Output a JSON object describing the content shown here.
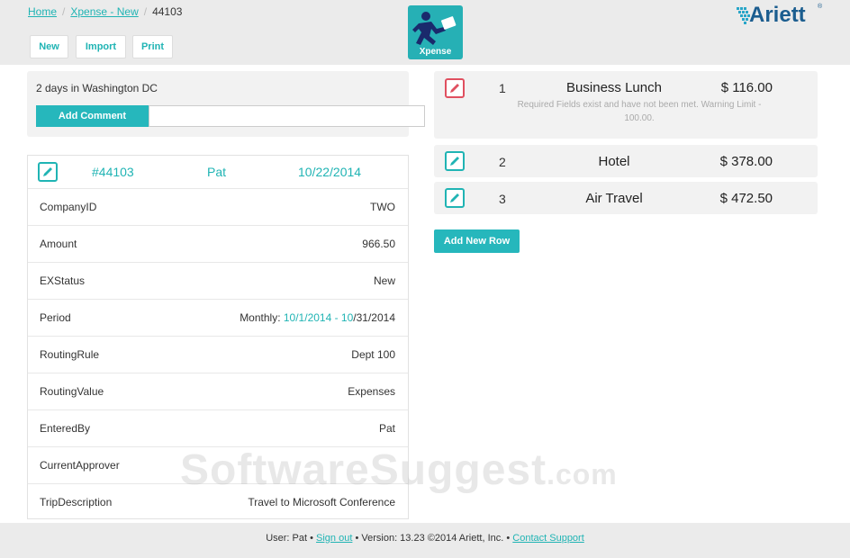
{
  "breadcrumb": {
    "home": "Home",
    "app": "Xpense - New",
    "current": "44103"
  },
  "toolbar": {
    "new_label": "New",
    "import_label": "Import",
    "print_label": "Print"
  },
  "app_logo": {
    "label": "Xpense",
    "icon": "running-man-icon",
    "color": "#26b0b5"
  },
  "brand": {
    "name": "Ariett",
    "mark": "®",
    "color": "#1b5d8f"
  },
  "comment": {
    "description": "2 days in Washington DC",
    "add_comment_label": "Add Comment",
    "input_value": ""
  },
  "report": {
    "id": "#44103",
    "user": "Pat",
    "date": "10/22/2014",
    "fields": [
      {
        "key": "CompanyID",
        "value": "TWO"
      },
      {
        "key": "Amount",
        "value": "966.50"
      },
      {
        "key": "EXStatus",
        "value": "New"
      },
      {
        "key": "Period",
        "value_prefix": "Monthly: ",
        "value_link1": "10/1/2014 - 10",
        "value_suffix": "/31/2014"
      },
      {
        "key": "RoutingRule",
        "value": "Dept 100"
      },
      {
        "key": "RoutingValue",
        "value": "Expenses"
      },
      {
        "key": "EnteredBy",
        "value": "Pat"
      },
      {
        "key": "CurrentApprover",
        "value": ""
      },
      {
        "key": "TripDescription",
        "value": "Travel to Microsoft Conference"
      }
    ]
  },
  "lines": [
    {
      "num": "1",
      "desc": "Business Lunch",
      "amount": "$ 116.00",
      "warning": "Required Fields exist and have not been met. Warning Limit - 100.00.",
      "status": "error"
    },
    {
      "num": "2",
      "desc": "Hotel",
      "amount": "$ 378.00",
      "warning": "",
      "status": "ok"
    },
    {
      "num": "3",
      "desc": "Air Travel",
      "amount": "$ 472.50",
      "warning": "",
      "status": "ok"
    }
  ],
  "add_row_label": "Add New Row",
  "footer": {
    "user_text": "User: Pat •",
    "sign_out": "Sign out",
    "version_text": "• Version: 13.23 ©2014 Ariett, Inc. •",
    "contact": "Contact Support"
  },
  "watermark": {
    "main": "SoftwareSuggest",
    "suffix": ".com"
  },
  "colors": {
    "accent": "#26b7bc",
    "error": "#e05060",
    "panel": "#f2f2f2",
    "topbar": "#ebebeb"
  }
}
